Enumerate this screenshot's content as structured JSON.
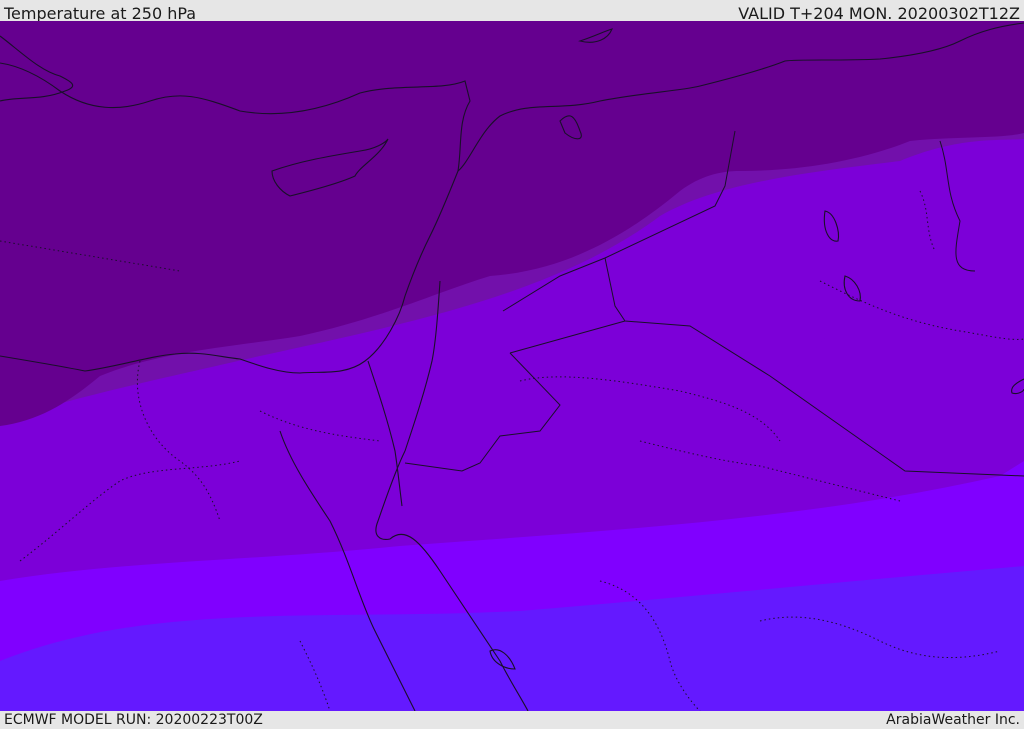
{
  "header": {
    "title": "Temperature at 250 hPa",
    "valid": "VALID T+204 MON. 20200302T12Z"
  },
  "footer": {
    "model_run": "ECMWF MODEL RUN: 20200223T00Z",
    "credit": "ArabiaWeather Inc."
  },
  "colors": {
    "band_coldest": "#65008f",
    "band_2": "#7210ab",
    "band_3": "#7c00d8",
    "band_4": "#8000ff",
    "band_warmest": "#6419ff",
    "lines": "#1a0f2a",
    "frame": "#e6e6e6"
  }
}
